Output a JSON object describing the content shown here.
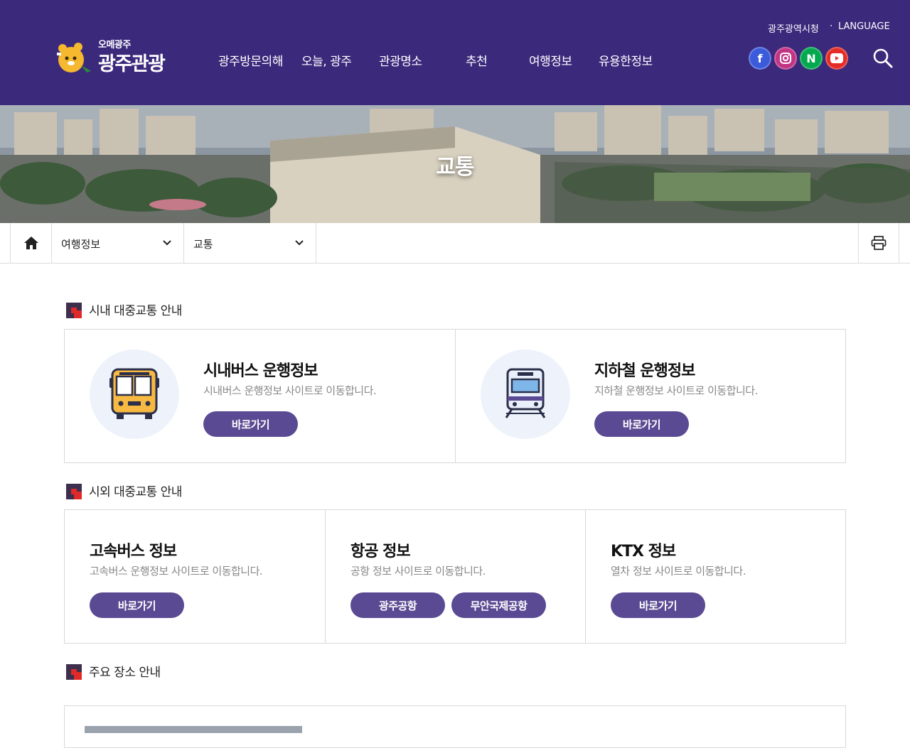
{
  "header": {
    "logo_small": "오메광주",
    "logo_big": "광주관광",
    "nav": [
      "광주방문의해",
      "오늘, 광주",
      "관광명소",
      "추천",
      "여행정보",
      "유용한정보"
    ],
    "util_city": "광주광역시청",
    "util_language": "LANGUAGE",
    "social": [
      {
        "name": "facebook",
        "glyph": "f",
        "color": "#3b5bdb"
      },
      {
        "name": "instagram",
        "glyph": "◎",
        "color": "#c13584"
      },
      {
        "name": "naver",
        "glyph": "N",
        "color": "#03a94f"
      },
      {
        "name": "youtube",
        "glyph": "▶",
        "color": "#e52d27"
      }
    ],
    "background": "#3b2a7c"
  },
  "banner": {
    "title": "교통"
  },
  "breadcrumb": {
    "level1": "여행정보",
    "level2": "교통"
  },
  "sections": {
    "city": {
      "title": "시내 대중교통 안내",
      "cards": [
        {
          "title": "시내버스 운행정보",
          "desc": "시내버스 운행정보 사이트로 이동합니다.",
          "button": "바로가기",
          "icon": "bus-icon"
        },
        {
          "title": "지하철 운행정보",
          "desc": "지하철 운행정보 사이트로 이동합니다.",
          "button": "바로가기",
          "icon": "subway-icon"
        }
      ]
    },
    "intercity": {
      "title": "시외 대중교통 안내",
      "cards": [
        {
          "title": "고속버스 정보",
          "desc": "고속버스 운행정보 사이트로 이동합니다.",
          "buttons": [
            "바로가기"
          ]
        },
        {
          "title": "항공 정보",
          "desc": "공항 정보 사이트로 이동합니다.",
          "buttons": [
            "광주공항",
            "무안국제공항"
          ]
        },
        {
          "title": "KTX 정보",
          "desc": "열차 정보 사이트로 이동합니다.",
          "buttons": [
            "바로가기"
          ]
        }
      ]
    },
    "places": {
      "title": "주요 장소 안내"
    }
  },
  "colors": {
    "accent": "#5a4a93",
    "section_icon": "#e02a2a"
  }
}
